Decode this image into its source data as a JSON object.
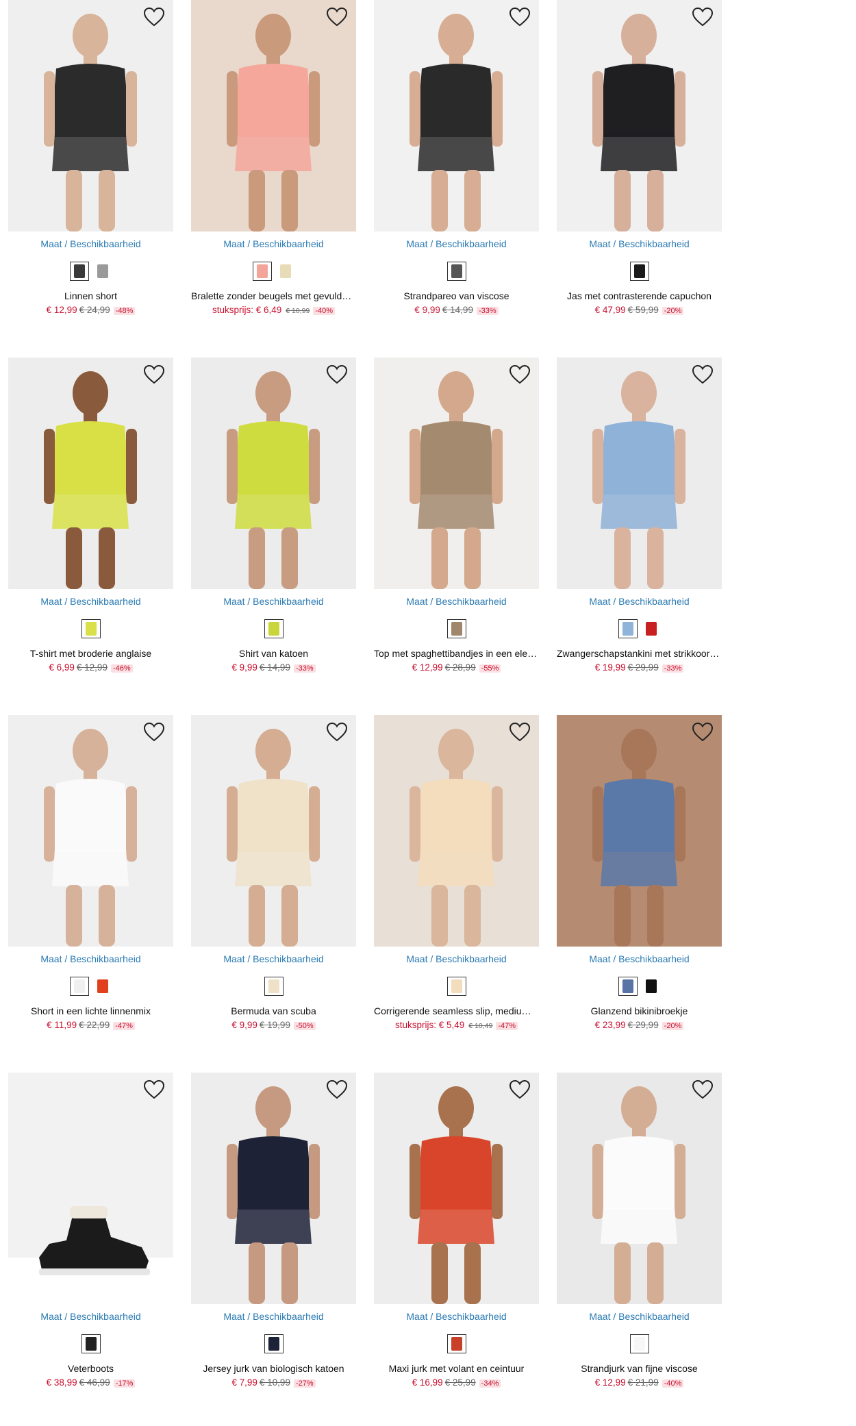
{
  "size_link_label": "Maat / Beschikbaarheid",
  "products": [
    {
      "name": "Linnen short",
      "price_now": "€ 12,99",
      "price_was": "€ 24,99",
      "discount": "-48%",
      "swatches": [
        "#3a3a3a",
        "#9a9a9a"
      ],
      "bg": "#efefef",
      "garment": "#2b2b2b",
      "skin": "#d8b49a"
    },
    {
      "name": "Bralette zonder beugels met gevulde cups en kant",
      "price_now": "stuksprijs: € 6,49",
      "price_was": "€ 10,99",
      "discount": "-40%",
      "swatches": [
        "#f3a59a",
        "#e8dcb8"
      ],
      "bg": "#e9d8cc",
      "garment": "#f5a79b",
      "skin": "#c99a7c"
    },
    {
      "name": "Strandpareo van viscose",
      "price_now": "€ 9,99",
      "price_was": "€ 14,99",
      "discount": "-33%",
      "swatches": [
        "#555555"
      ],
      "bg": "#f1f1f1",
      "garment": "#2a2a2a",
      "skin": "#d7ad93"
    },
    {
      "name": "Jas met contrasterende capuchon",
      "price_now": "€ 47,99",
      "price_was": "€ 59,99",
      "discount": "-20%",
      "swatches": [
        "#1a1a1a"
      ],
      "bg": "#f0f0f0",
      "garment": "#1f1f22",
      "skin": "#d6b09b"
    },
    {
      "name": "T-shirt met broderie anglaise",
      "price_now": "€ 6,99",
      "price_was": "€ 12,99",
      "discount": "-46%",
      "swatches": [
        "#d9e04a"
      ],
      "bg": "#ededed",
      "garment": "#d8e046",
      "skin": "#8a5a3c"
    },
    {
      "name": "Shirt van katoen",
      "price_now": "€ 9,99",
      "price_was": "€ 14,99",
      "discount": "-33%",
      "swatches": [
        "#c8d63c"
      ],
      "bg": "#ececec",
      "garment": "#cfdc3f",
      "skin": "#c89c80"
    },
    {
      "name": "Top met spaghettibandjes in een elegante look",
      "price_now": "€ 12,99",
      "price_was": "€ 28,99",
      "discount": "-55%",
      "swatches": [
        "#a0866a"
      ],
      "bg": "#f0efed",
      "garment": "#a48a6e",
      "skin": "#d3a88c"
    },
    {
      "name": "Zwangerschapstankini met strikkoordjes",
      "price_now": "€ 19,99",
      "price_was": "€ 29,99",
      "discount": "-33%",
      "swatches": [
        "#8fb3d9",
        "#c82020"
      ],
      "bg": "#ececec",
      "garment": "#8fb2d8",
      "skin": "#d9b39d"
    },
    {
      "name": "Short in een lichte linnenmix",
      "price_now": "€ 11,99",
      "price_was": "€ 22,99",
      "discount": "-47%",
      "swatches": [
        "#f0f0f0",
        "#e0401c"
      ],
      "bg": "#efefef",
      "garment": "#fafafa",
      "skin": "#d6b29a"
    },
    {
      "name": "Bermuda van scuba",
      "price_now": "€ 9,99",
      "price_was": "€ 19,99",
      "discount": "-50%",
      "swatches": [
        "#efe1c8"
      ],
      "bg": "#eeeeee",
      "garment": "#efe2c9",
      "skin": "#d4ad93"
    },
    {
      "name": "Corrigerende seamless slip, medium shape",
      "price_now": "stuksprijs: € 5,49",
      "price_was": "€ 10,49",
      "discount": "-47%",
      "swatches": [
        "#f2ddbc"
      ],
      "bg": "#e8dfd6",
      "garment": "#f3ddbd",
      "skin": "#d9b69c"
    },
    {
      "name": "Glanzend bikinibroekje",
      "price_now": "€ 23,99",
      "price_was": "€ 29,99",
      "discount": "-20%",
      "swatches": [
        "#5873a6",
        "#111111"
      ],
      "bg": "#b58c72",
      "garment": "#5a78a8",
      "skin": "#a8775a"
    },
    {
      "name": "Veterboots",
      "price_now": "€ 38,99",
      "price_was": "€ 46,99",
      "discount": "-17%",
      "swatches": [
        "#222222"
      ],
      "bg": "#f2f2f2",
      "garment": "#1b1b1b",
      "skin": "#f2f2f2"
    },
    {
      "name": "Jersey jurk van biologisch katoen",
      "price_now": "€ 7,99",
      "price_was": "€ 10,99",
      "discount": "-27%",
      "swatches": [
        "#1c2238"
      ],
      "bg": "#ededed",
      "garment": "#1d2237",
      "skin": "#c59a80"
    },
    {
      "name": "Maxi jurk met volant en ceintuur",
      "price_now": "€ 16,99",
      "price_was": "€ 25,99",
      "discount": "-34%",
      "swatches": [
        "#c8402a"
      ],
      "bg": "#ededed",
      "garment": "#d9452a",
      "skin": "#a8724f"
    },
    {
      "name": "Strandjurk van fijne viscose",
      "price_now": "€ 12,99",
      "price_was": "€ 21,99",
      "discount": "-40%",
      "swatches": [
        "#f7f7f7"
      ],
      "bg": "#e9e9e9",
      "garment": "#fbfbfb",
      "skin": "#d4ad95"
    }
  ]
}
